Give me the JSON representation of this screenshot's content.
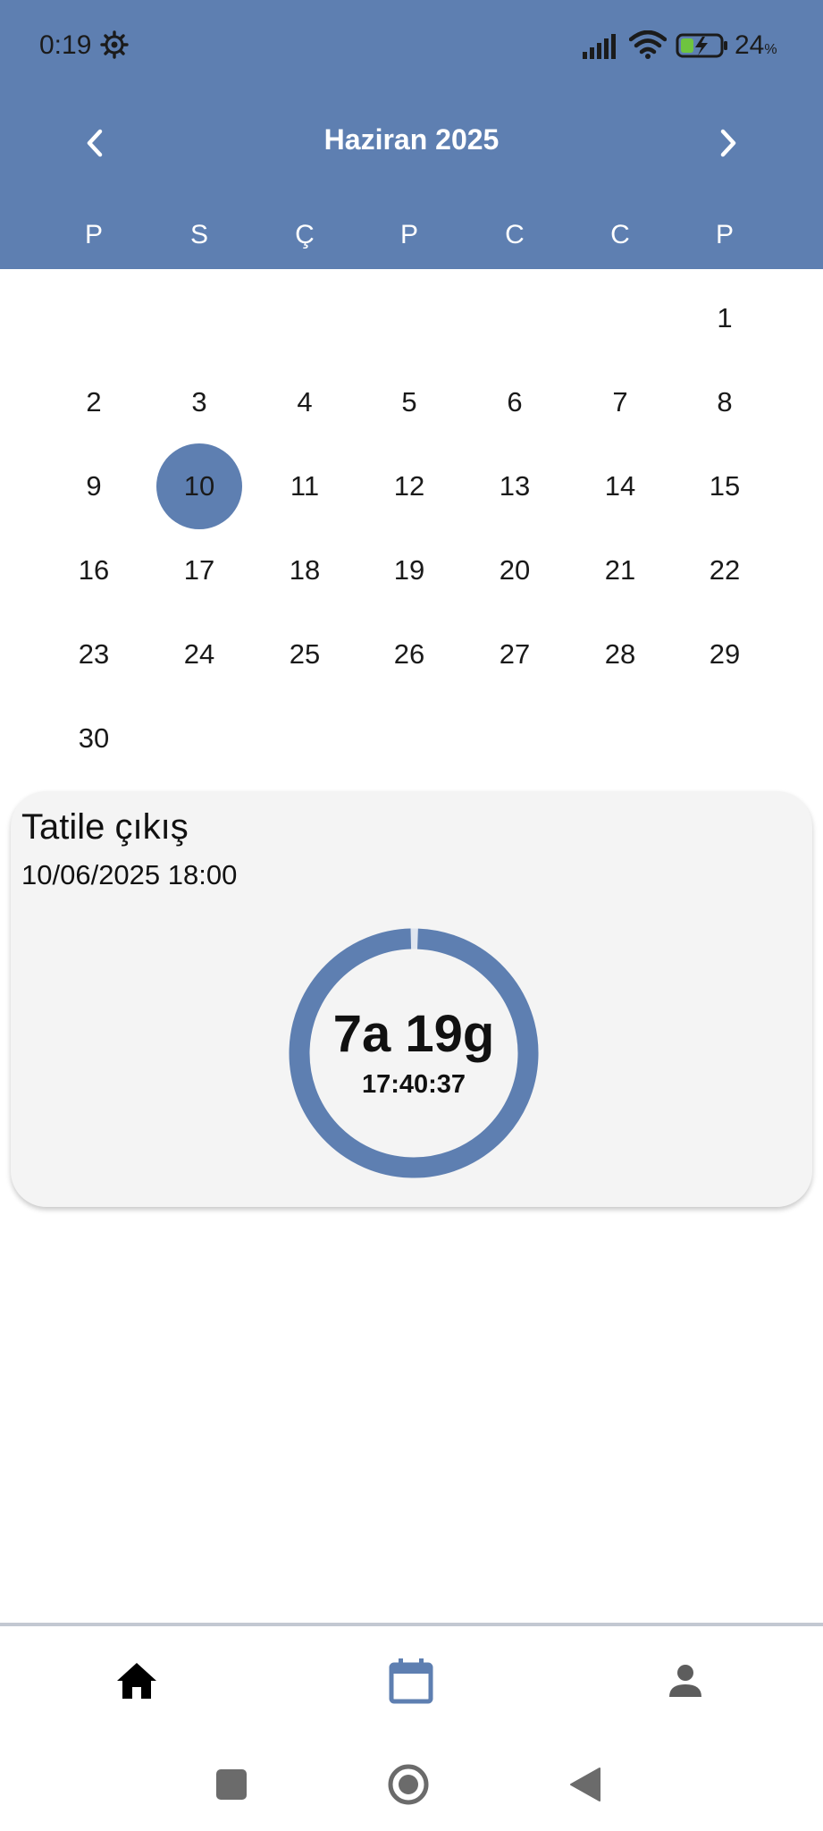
{
  "status_bar": {
    "time": "0:19",
    "battery_percent": "24",
    "battery_unit": "%"
  },
  "calendar": {
    "month_title": "Haziran 2025",
    "weekdays": [
      "P",
      "S",
      "Ç",
      "P",
      "C",
      "C",
      "P"
    ],
    "selected_day": "10",
    "days": {
      "d1": "1",
      "d2": "2",
      "d3": "3",
      "d4": "4",
      "d5": "5",
      "d6": "6",
      "d7": "7",
      "d8": "8",
      "d9": "9",
      "d10": "10",
      "d11": "11",
      "d12": "12",
      "d13": "13",
      "d14": "14",
      "d15": "15",
      "d16": "16",
      "d17": "17",
      "d18": "18",
      "d19": "19",
      "d20": "20",
      "d21": "21",
      "d22": "22",
      "d23": "23",
      "d24": "24",
      "d25": "25",
      "d26": "26",
      "d27": "27",
      "d28": "28",
      "d29": "29",
      "d30": "30"
    }
  },
  "event": {
    "title": "Tatile çıkış",
    "datetime": "10/06/2025 18:00",
    "countdown_main": "7a 19g",
    "countdown_time": "17:40:37",
    "ring_progress": 0.99
  },
  "bottom_nav": {
    "tabs": [
      {
        "icon": "home-icon",
        "active": false
      },
      {
        "icon": "calendar-icon",
        "active": true
      },
      {
        "icon": "person-icon",
        "active": false
      }
    ]
  },
  "colors": {
    "primary": "#5e7fb1",
    "card_bg": "#f4f4f4",
    "ring_gap": "#dfe5ef"
  }
}
